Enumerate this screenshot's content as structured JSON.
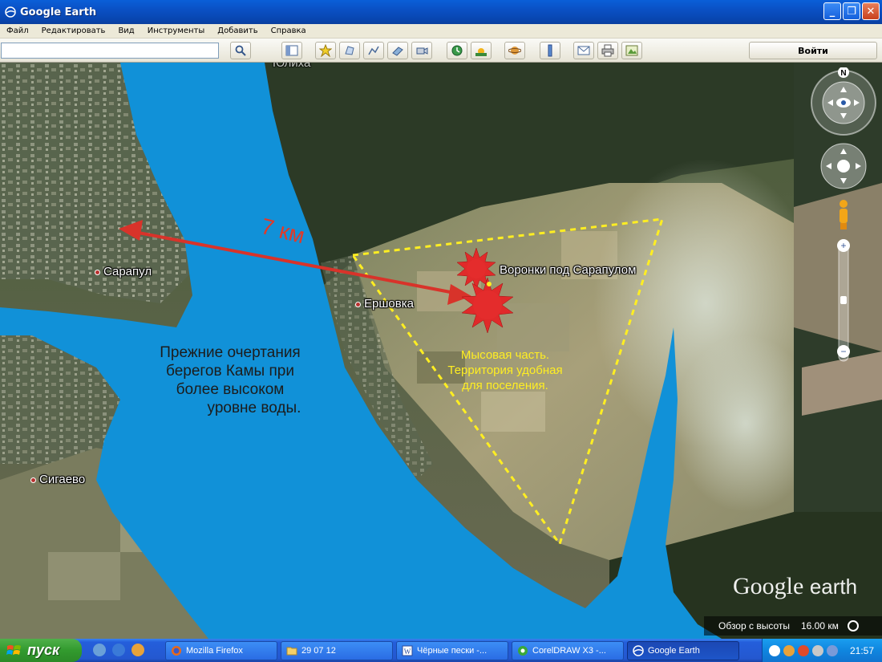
{
  "window": {
    "title": "Google Earth",
    "controls": {
      "minimize": "_",
      "maximize": "❐",
      "close": "✕"
    }
  },
  "menu": [
    "Файл",
    "Редактировать",
    "Вид",
    "Инструменты",
    "Добавить",
    "Справка"
  ],
  "toolbar": {
    "search_value": "",
    "login_label": "Войти",
    "icons": [
      "sidebar-toggle-icon",
      "placemark-icon",
      "polygon-icon",
      "path-icon",
      "image-overlay-icon",
      "record-tour-icon",
      "historical-imagery-icon",
      "sun-icon",
      "planets-icon",
      "ruler-icon",
      "email-icon",
      "print-icon",
      "save-image-icon"
    ]
  },
  "map": {
    "places": {
      "sarapul": "Сарапул",
      "ershovka": "Ершовка",
      "sigaevo": "Сигаево",
      "lipovka_partial": "Юлиха",
      "craters": "Воронки под Сарапулом"
    },
    "annotations": {
      "distance": "7 км",
      "old_shore": [
        "Прежние очертания",
        "берегов Камы при",
        "более высоком",
        "уровне воды."
      ],
      "cape": [
        "Мысовая часть.",
        "Территория удобная",
        "для поселения."
      ]
    },
    "colors": {
      "water": "#1191d8",
      "arrow": "#d8332a",
      "outline": "#ffee22",
      "crater": "#e02a2a"
    },
    "nav": {
      "north": "N"
    },
    "logo": {
      "google": "Google",
      "earth": "earth"
    },
    "altitude": {
      "label": "Обзор с высоты",
      "value": "16.00 км"
    }
  },
  "taskbar": {
    "start_label": "пуск",
    "tasks": [
      {
        "label": "Mozilla Firefox"
      },
      {
        "label": "29 07 12"
      },
      {
        "label": "Чёрные пески -..."
      },
      {
        "label": "CorelDRAW X3 -..."
      },
      {
        "label": "Google Earth"
      }
    ],
    "clock": "21:57"
  }
}
